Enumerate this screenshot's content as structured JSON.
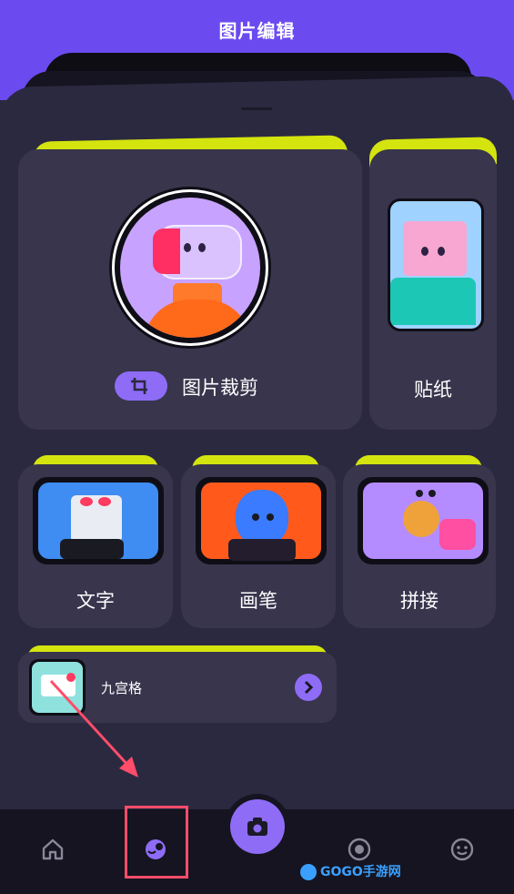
{
  "header": {
    "title": "图片编辑"
  },
  "tools": {
    "crop": {
      "label": "图片裁剪",
      "icon": "crop-icon"
    },
    "sticker": {
      "label": "贴纸"
    },
    "text": {
      "label": "文字"
    },
    "pen": {
      "label": "画笔"
    },
    "join": {
      "label": "拼接"
    },
    "grid": {
      "label": "九宫格",
      "icon": "chevron-right-icon"
    }
  },
  "tabbar": {
    "items": [
      {
        "name": "home",
        "icon": "home-icon"
      },
      {
        "name": "edit",
        "icon": "palette-icon"
      },
      {
        "name": "camera",
        "icon": "camera-icon"
      },
      {
        "name": "record",
        "icon": "record-icon"
      },
      {
        "name": "face",
        "icon": "smiley-icon"
      }
    ]
  },
  "watermark": {
    "text": "GOGO手游网"
  },
  "colors": {
    "accent": "#8e6cf6",
    "lime": "#d4e40e",
    "header_bg": "#6b4bf0",
    "card_bg": "#38354d",
    "highlight": "#ff4d6a"
  }
}
